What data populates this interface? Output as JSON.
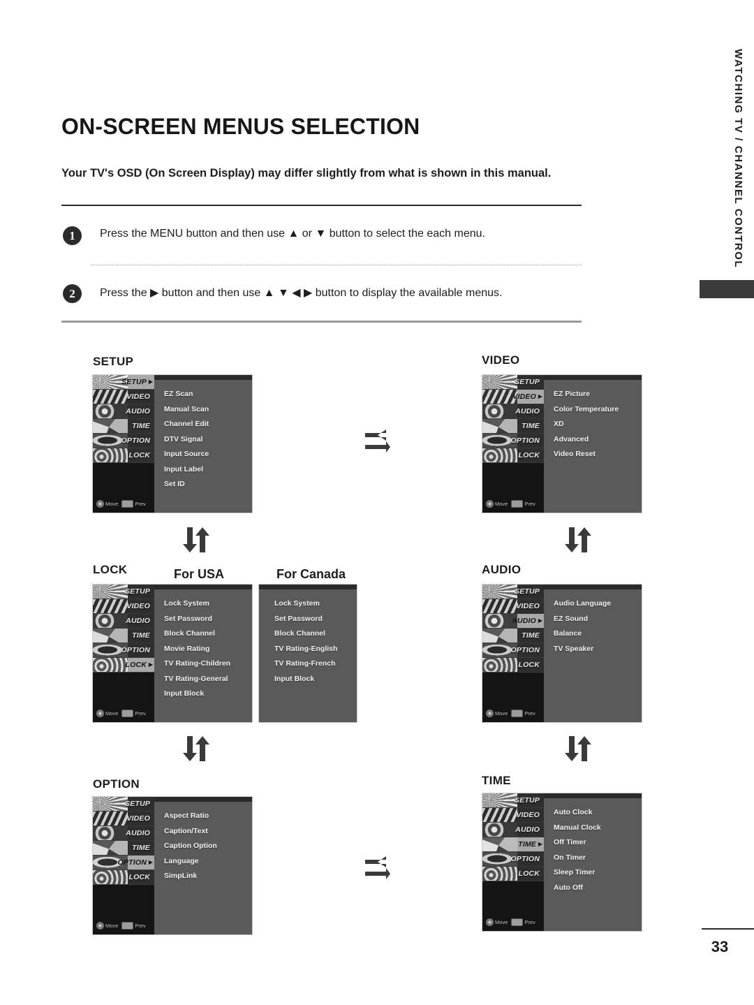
{
  "page": {
    "title": "ON-SCREEN MENUS SELECTION",
    "intro": "Your TV's OSD (On Screen Display) may differ slightly from what is shown in this manual.",
    "page_number": "33",
    "side_tab": "WATCHING TV / CHANNEL CONTROL"
  },
  "steps": [
    {
      "num": "1",
      "text_before": "Press the ",
      "bold": "MENU",
      "text_after": " button and then use ▲ or ▼ button to select the each menu."
    },
    {
      "num": "2",
      "text_before": "Press the ▶ button and then use ▲ ▼ ◀ ▶ button to display the available menus.",
      "bold": "",
      "text_after": ""
    }
  ],
  "step1_full": "Press the MENU button and then use ▲ or ▼ button to select the each menu.",
  "step2_full": "Press the ▶ button and then use ▲ ▼ ◀ ▶ button to display the available menus.",
  "osd_tabs": [
    "SETUP",
    "VIDEO",
    "AUDIO",
    "TIME",
    "OPTION",
    "LOCK"
  ],
  "osd_footer": {
    "move_label": "Move",
    "prev_label": "Prev"
  },
  "menus": {
    "setup": {
      "label": "SETUP",
      "selected_tab": "SETUP",
      "items": [
        "EZ Scan",
        "Manual Scan",
        "Channel Edit",
        "DTV Signal",
        "Input Source",
        "Input Label",
        "Set ID"
      ]
    },
    "video": {
      "label": "VIDEO",
      "selected_tab": "VIDEO",
      "items": [
        "EZ Picture",
        "Color Temperature",
        "XD",
        "Advanced",
        "Video Reset"
      ]
    },
    "lock_usa": {
      "label": "LOCK",
      "variant": "For USA",
      "selected_tab": "LOCK",
      "items": [
        "Lock System",
        "Set Password",
        "Block Channel",
        "Movie Rating",
        "TV Rating-Children",
        "TV Rating-General",
        "Input Block"
      ]
    },
    "lock_canada": {
      "variant": "For Canada",
      "items": [
        "Lock System",
        "Set Password",
        "Block Channel",
        "TV Rating-English",
        "TV Rating-French",
        "Input Block"
      ]
    },
    "audio": {
      "label": "AUDIO",
      "selected_tab": "AUDIO",
      "items": [
        "Audio Language",
        "EZ Sound",
        "Balance",
        "TV Speaker"
      ]
    },
    "option": {
      "label": "OPTION",
      "selected_tab": "OPTION",
      "items": [
        "Aspect Ratio",
        "Caption/Text",
        "Caption Option",
        "Language",
        "SimpLink"
      ]
    },
    "time": {
      "label": "TIME",
      "selected_tab": "TIME",
      "items": [
        "Auto Clock",
        "Manual Clock",
        "Off Timer",
        "On Timer",
        "Sleep Timer",
        "Auto Off"
      ]
    }
  },
  "colors": {
    "osd_background": "#5a5a5a",
    "osd_sidebar": "#141414",
    "osd_selected_tab": "#a9a9a9",
    "ink": "#1c1c1c",
    "side_tab_block": "#3b3b3b"
  }
}
